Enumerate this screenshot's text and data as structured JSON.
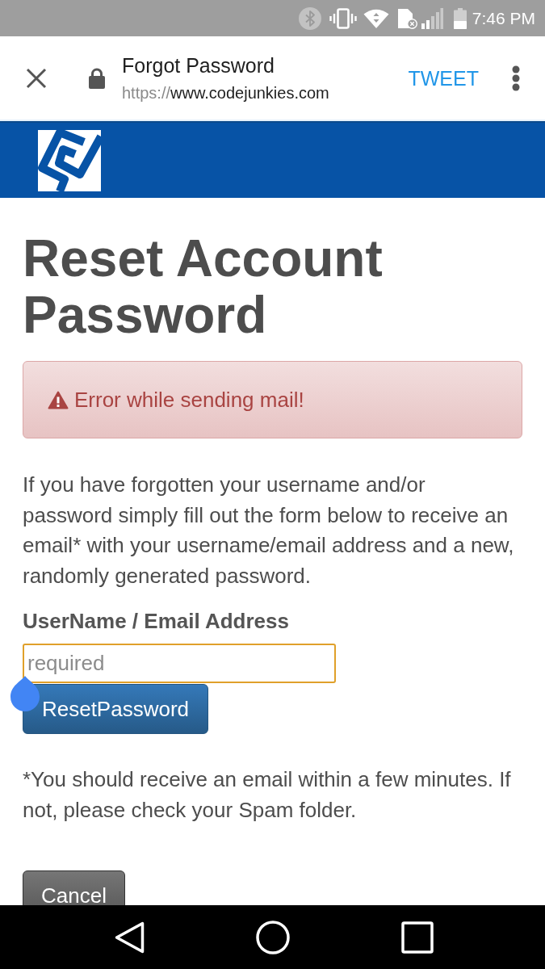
{
  "status_bar": {
    "time": "7:46 PM"
  },
  "toolbar": {
    "title": "Forgot Password",
    "url_scheme": "https://",
    "url_host": "www.codejunkies.com",
    "action": "TWEET"
  },
  "page": {
    "heading": "Reset Account Password",
    "alert": {
      "kind": "error",
      "text": "Error while sending mail!"
    },
    "intro": "If you have forgotten your username and/or password simply fill out the form below to receive an email* with your username/email address and a new, randomly generated password.",
    "field": {
      "label": "UserName / Email Address",
      "placeholder": "required",
      "focused": true
    },
    "submit_button": "ResetPassword",
    "note": "*You should receive an email within a few minutes. If not, please check your Spam folder.",
    "cancel_button": "Cancel"
  }
}
